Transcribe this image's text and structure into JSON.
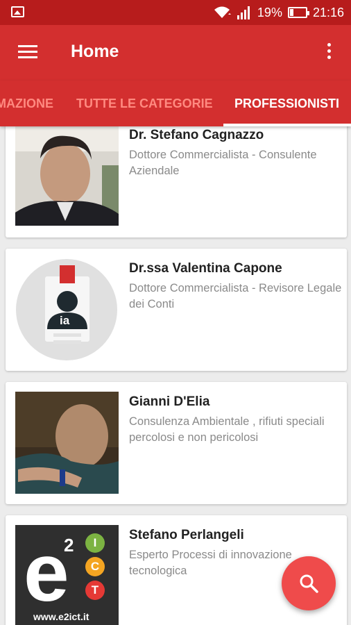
{
  "status_bar": {
    "battery": "19%",
    "battery_level": 0.19,
    "time": "21:16",
    "icons": [
      "gallery-icon",
      "wifi-icon",
      "signal-icon",
      "battery-icon"
    ]
  },
  "app_bar": {
    "title": "Home",
    "icons": [
      "menu-icon",
      "more-vert-icon"
    ]
  },
  "tabs": [
    "MAZIONE",
    "TUTTE LE CATEGORIE",
    "PROFESSIONISTI"
  ],
  "active_tab": "PROFESSIONISTI",
  "professionals": [
    {
      "name": "Dr. Stefano Cagnazzo",
      "description": "Dottore Commercialista - Consulente Aziendale"
    },
    {
      "name": "Dr.ssa Valentina Capone",
      "description": "Dottore Commercialista - Revisore Legale dei Conti"
    },
    {
      "name": "Gianni D'Elia",
      "description": "Consulenza Ambientale , rifiuti speciali percolosi e non pericolosi"
    },
    {
      "name": "Stefano Perlangeli",
      "description": "Esperto Processi di innovazione tecnologica"
    }
  ],
  "logo_texts": {
    "placeholder_badge": "ia",
    "e2ict_e": "e",
    "e2ict_2": "2",
    "e2ict_letters": [
      "I",
      "C",
      "T"
    ],
    "e2ict_url": "www.e2ict.it"
  },
  "colors": {
    "status_bar": "#b71c1c",
    "app_bar": "#d32f2f",
    "tab_inactive": "#ff8a80",
    "fab": "#ef4b4b"
  },
  "fab": {
    "icon": "search-icon"
  }
}
